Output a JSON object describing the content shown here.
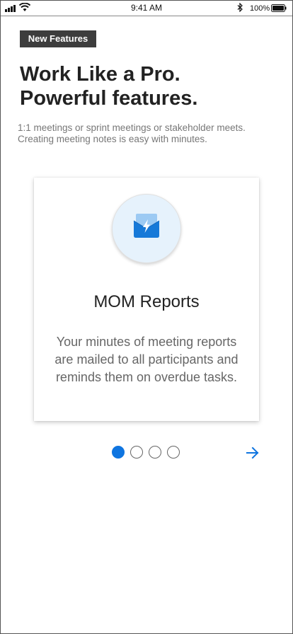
{
  "status_bar": {
    "time": "9:41 AM",
    "battery_percent": "100%"
  },
  "badge": "New Features",
  "headline": {
    "line1": "Work Like a Pro.",
    "line2": "Powerful features."
  },
  "intro": {
    "line1": "1:1  meetings or sprint meetings or stakeholder meets.",
    "line2": "Creating meeting notes is easy with minutes."
  },
  "feature_card": {
    "icon": "mail-lightning-icon",
    "title": "MOM Reports",
    "description_lines": [
      "Your minutes of meeting reports",
      "are mailed to all participants and",
      "reminds them on overdue tasks."
    ]
  },
  "pagination": {
    "total": 4,
    "active_index": 0
  },
  "colors": {
    "accent": "#0f75e0",
    "badge_bg": "#3d3d3d",
    "icon_circle_bg": "#e6f2fc"
  }
}
